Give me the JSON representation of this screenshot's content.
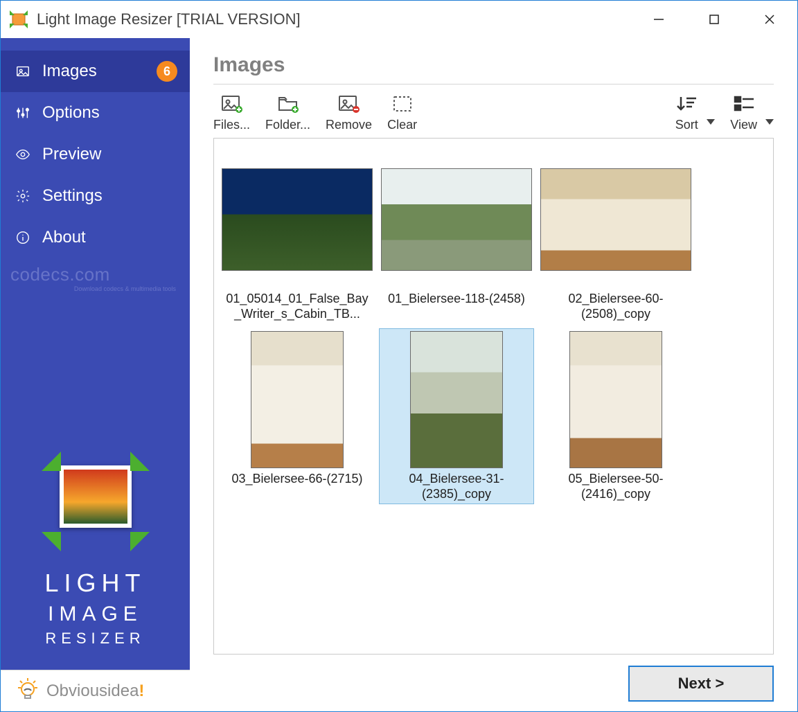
{
  "window": {
    "title": "Light Image Resizer  [TRIAL VERSION]"
  },
  "sidebar": {
    "items": [
      {
        "label": "Images",
        "badge": "6"
      },
      {
        "label": "Options"
      },
      {
        "label": "Preview"
      },
      {
        "label": "Settings"
      },
      {
        "label": "About"
      }
    ],
    "codecs": "codecs.com",
    "codecs_sub": "Download codecs  & multimedia tools",
    "brand1": "LIGHT",
    "brand2": "IMAGE",
    "brand3": "RESIZER",
    "idea_text": "Obviousidea",
    "idea_excl": "!"
  },
  "page": {
    "title": "Images"
  },
  "toolbar": {
    "files": "Files...",
    "folder": "Folder...",
    "remove": "Remove",
    "clear": "Clear",
    "sort": "Sort",
    "view": "View"
  },
  "thumbs": [
    {
      "name": "01_05014_01_False_Bay_Writer_s_Cabin_TB...",
      "shape": "wide",
      "cls": "t0",
      "selected": false
    },
    {
      "name": "01_Bielersee-118-(2458)",
      "shape": "wide",
      "cls": "t1",
      "selected": false
    },
    {
      "name": "02_Bielersee-60-(2508)_copy",
      "shape": "wide",
      "cls": "t2",
      "selected": false
    },
    {
      "name": "03_Bielersee-66-(2715)",
      "shape": "tall",
      "cls": "t3",
      "selected": false
    },
    {
      "name": "04_Bielersee-31-(2385)_copy",
      "shape": "tall",
      "cls": "t4",
      "selected": true
    },
    {
      "name": "05_Bielersee-50-(2416)_copy",
      "shape": "tall",
      "cls": "t5",
      "selected": false
    }
  ],
  "footer": {
    "next": "Next >"
  }
}
